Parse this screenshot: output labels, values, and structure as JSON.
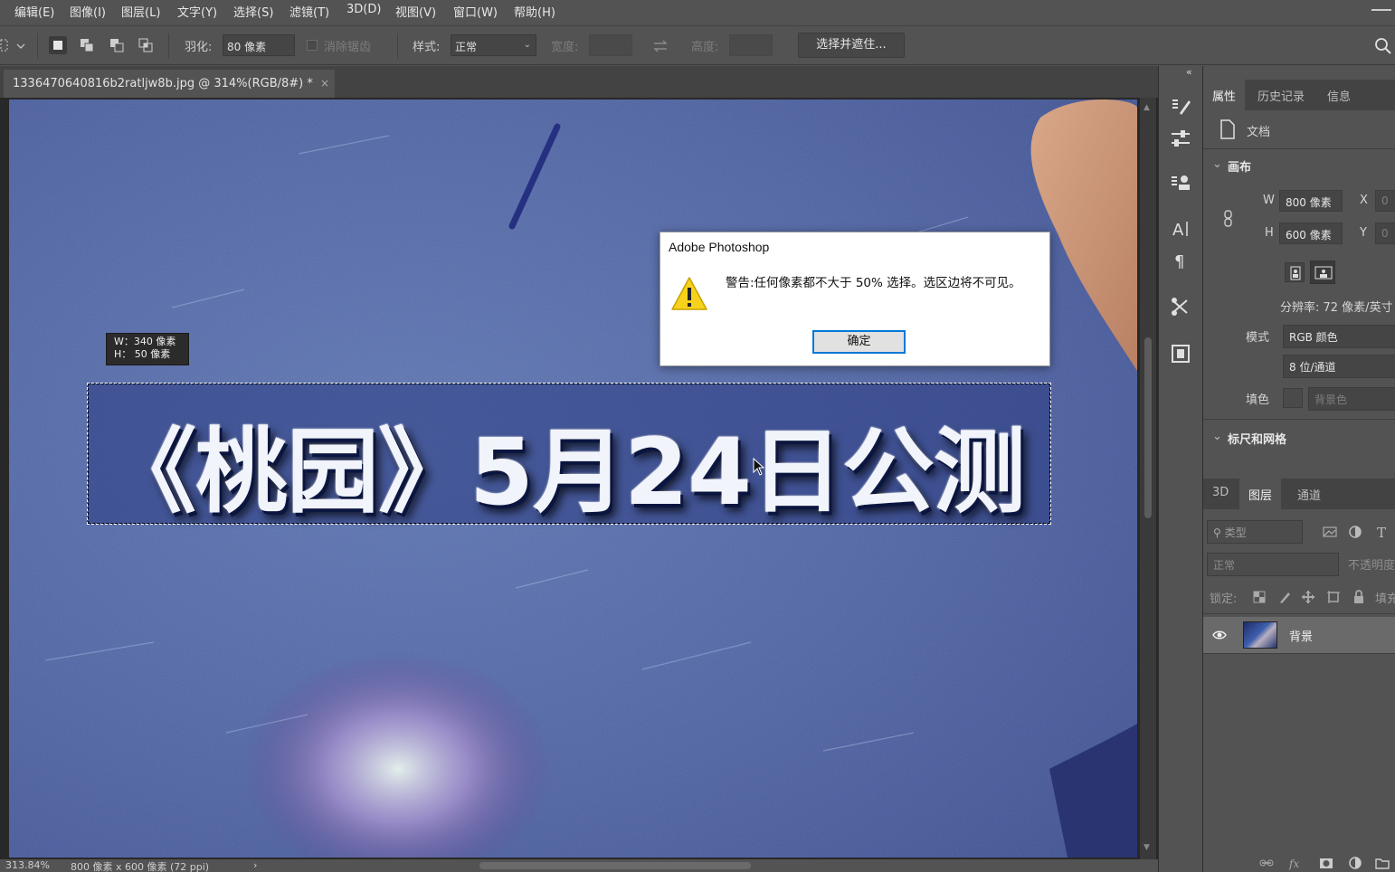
{
  "menu": [
    "编辑(E)",
    "图像(I)",
    "图层(L)",
    "文字(Y)",
    "选择(S)",
    "滤镜(T)",
    "3D(D)",
    "视图(V)",
    "窗口(W)",
    "帮助(H)"
  ],
  "options_bar": {
    "feather_label": "羽化:",
    "feather_value": "80 像素",
    "antialias_label": "消除锯齿",
    "style_label": "样式:",
    "style_value": "正常",
    "width_label": "宽度:",
    "height_label": "高度:",
    "select_mask_button": "选择并遮住..."
  },
  "document": {
    "tab_title": "1336470640816b2ratljw8b.jpg @ 314%(RGB/8#) *",
    "close": "×",
    "banner_text": "《桃园》5月24日公测",
    "selection_tooltip": {
      "w": "W：340 像素",
      "h": "H：  50 像素"
    }
  },
  "dialog": {
    "title": "Adobe Photoshop",
    "message": "警告:任何像素都不大于 50% 选择。选区边将不可见。",
    "ok_label": "确定"
  },
  "status_bar": {
    "zoom": "313.84%",
    "doc_info": "800 像素 x 600 像素 (72 ppi)",
    "arrow": "›"
  },
  "properties_panel": {
    "tabs": [
      "属性",
      "历史记录",
      "信息"
    ],
    "doc_label": "文档",
    "canvas_section": "画布",
    "w_label": "W",
    "w_value": "800 像素",
    "h_label": "H",
    "h_value": "600 像素",
    "x_label": "X",
    "x_value": "0",
    "y_label": "Y",
    "y_value": "0",
    "resolution": "分辨率: 72 像素/英寸",
    "mode_label": "模式",
    "mode_value": "RGB 颜色",
    "depth_value": "8 位/通道",
    "fill_label": "填色",
    "fill_value": "背景色",
    "rulers_section": "标尺和网格"
  },
  "layers_panel": {
    "tabs": [
      "3D",
      "图层",
      "通道"
    ],
    "filter_placeholder": "类型",
    "blend_mode": "正常",
    "opacity_label": "不透明度:",
    "lock_label": "锁定:",
    "fill_label": "填充:",
    "layers": [
      {
        "name": "背景"
      }
    ]
  }
}
